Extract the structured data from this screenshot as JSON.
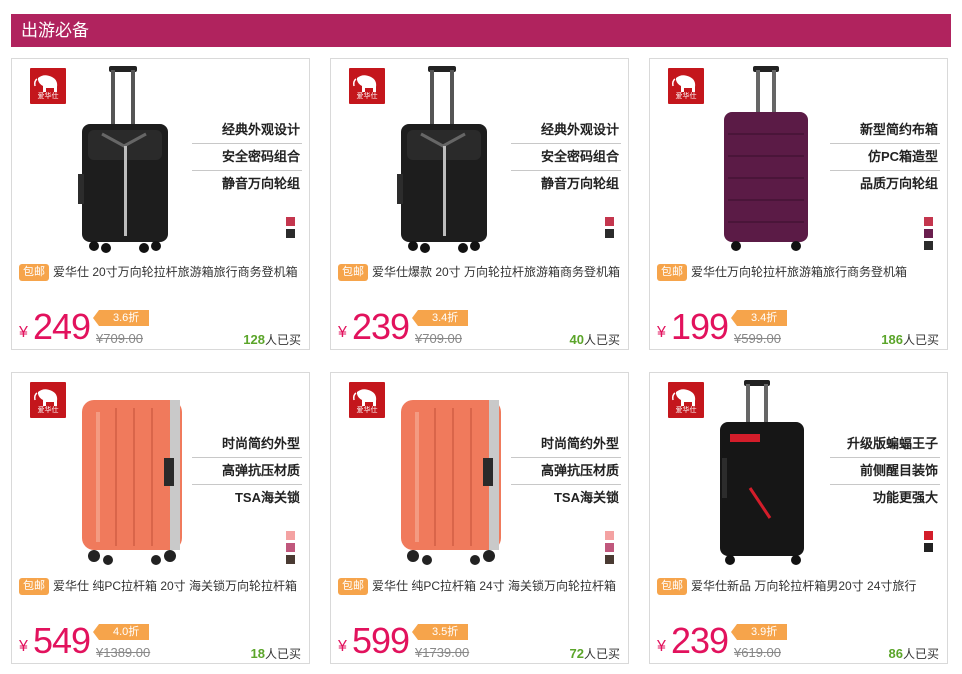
{
  "header": {
    "title": "出游必备"
  },
  "colors": {
    "header_bg": "#b0235e",
    "price": "#e2125d",
    "badge": "#f6a44b",
    "sold_count": "#5ba52a"
  },
  "products": [
    {
      "logo_text": "爱华仕",
      "features": [
        "经典外观设计",
        "安全密码组合",
        "静音万向轮组"
      ],
      "swatches": [
        "#c4364e",
        "#2b2b2b"
      ],
      "badge": "包邮",
      "title": "爱华仕 20寸万向轮拉杆旅游箱旅行商务登机箱",
      "yen": "¥",
      "price": "249",
      "discount": "3.6折",
      "original_price": "¥709.00",
      "sold_count": "128",
      "sold_suffix": "人已买",
      "suitcase": "black-soft"
    },
    {
      "logo_text": "爱华仕",
      "features": [
        "经典外观设计",
        "安全密码组合",
        "静音万向轮组"
      ],
      "swatches": [
        "#c4364e",
        "#2b2b2b"
      ],
      "badge": "包邮",
      "title": "爱华仕爆款 20寸 万向轮拉杆旅游箱商务登机箱",
      "yen": "¥",
      "price": "239",
      "discount": "3.4折",
      "original_price": "¥709.00",
      "sold_count": "40",
      "sold_suffix": "人已买",
      "suitcase": "black-soft"
    },
    {
      "logo_text": "爱华仕",
      "features": [
        "新型简约布箱",
        "仿PC箱造型",
        "品质万向轮组"
      ],
      "swatches": [
        "#c4364e",
        "#6a1e4e",
        "#2b2b2b"
      ],
      "badge": "包邮",
      "title": "爱华仕万向轮拉杆旅游箱旅行商务登机箱",
      "yen": "¥",
      "price": "199",
      "discount": "3.4折",
      "original_price": "¥599.00",
      "sold_count": "186",
      "sold_suffix": "人已买",
      "suitcase": "purple"
    },
    {
      "logo_text": "爱华仕",
      "features": [
        "时尚简约外型",
        "高弹抗压材质",
        "TSA海关锁"
      ],
      "swatches": [
        "#f4a2a2",
        "#c0577c",
        "#4a3a32"
      ],
      "badge": "包邮",
      "title": "爱华仕 纯PC拉杆箱 20寸 海关锁万向轮拉杆箱",
      "yen": "¥",
      "price": "549",
      "discount": "4.0折",
      "original_price": "¥1389.00",
      "sold_count": "18",
      "sold_suffix": "人已买",
      "suitcase": "orange"
    },
    {
      "logo_text": "爱华仕",
      "features": [
        "时尚简约外型",
        "高弹抗压材质",
        "TSA海关锁"
      ],
      "swatches": [
        "#f4a2a2",
        "#c0577c",
        "#4a3a32"
      ],
      "badge": "包邮",
      "title": "爱华仕 纯PC拉杆箱 24寸 海关锁万向轮拉杆箱",
      "yen": "¥",
      "price": "599",
      "discount": "3.5折",
      "original_price": "¥1739.00",
      "sold_count": "72",
      "sold_suffix": "人已买",
      "suitcase": "orange"
    },
    {
      "logo_text": "爱华仕",
      "features": [
        "升级版蝙蝠王子",
        "前侧醒目装饰",
        "功能更强大"
      ],
      "swatches": [
        "#d31d2a",
        "#222222"
      ],
      "badge": "包邮",
      "title": "爱华仕新品 万向轮拉杆箱男20寸 24寸旅行",
      "yen": "¥",
      "price": "239",
      "discount": "3.9折",
      "original_price": "¥619.00",
      "sold_count": "86",
      "sold_suffix": "人已买",
      "suitcase": "black-red"
    }
  ]
}
